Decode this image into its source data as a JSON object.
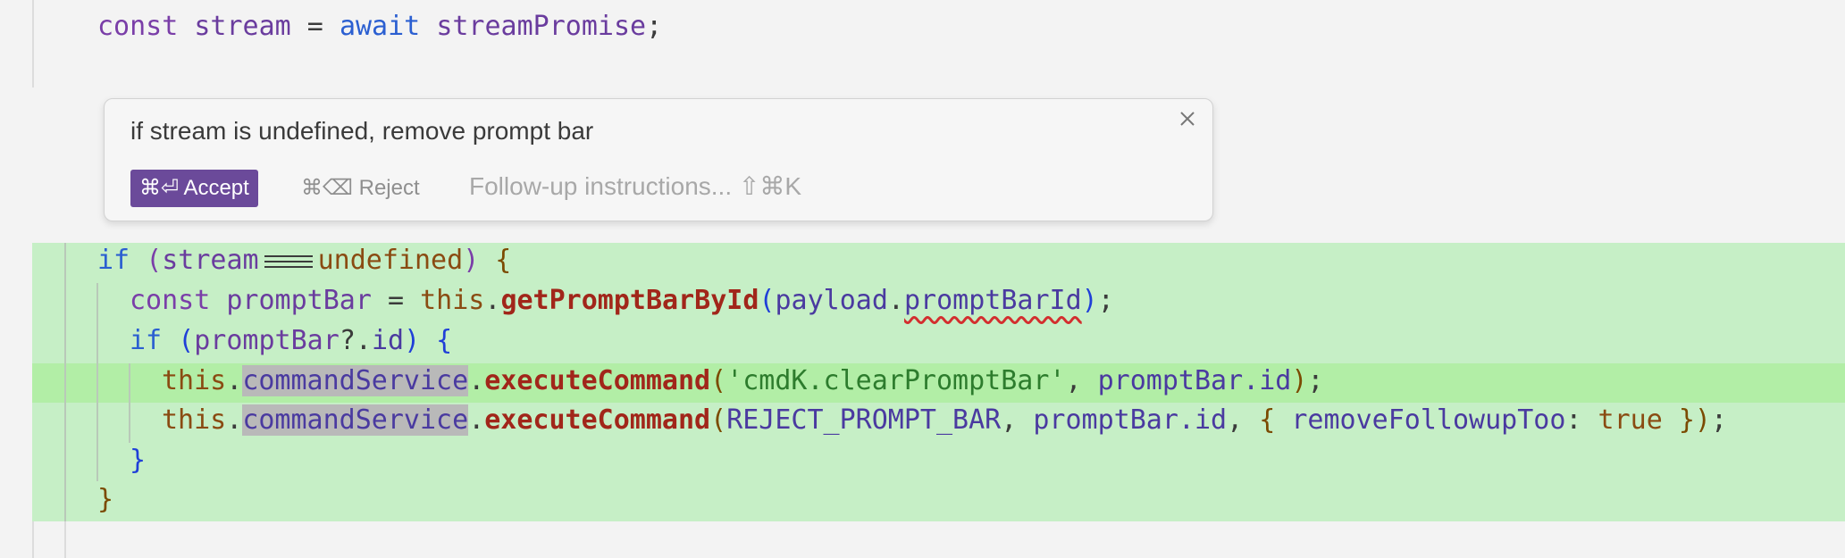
{
  "prompt_bar": {
    "instruction": "if stream is undefined, remove prompt bar",
    "accept_label": "⌘⏎ Accept",
    "reject_label": "⌘⌫ Reject",
    "followup_placeholder": "Follow-up instructions... ⇧⌘K"
  },
  "colors": {
    "added_background": "#c6efc6",
    "added_line_highlight": "#b2eea6",
    "accept_button": "#6b4a9a"
  },
  "code": {
    "line1": {
      "kw_const": "const ",
      "var_stream": "stream",
      "eq": " = ",
      "kw_await": "await ",
      "var_promise": "streamPromise",
      "semi": ";"
    },
    "line2": {
      "kw_if": "if ",
      "lp": "(",
      "var_stream": "stream",
      "var_undefined": "undefined",
      "rp": ")",
      "lb": " {"
    },
    "line3": {
      "kw_const": "const ",
      "var_promptbar": "promptBar",
      "eq": " = ",
      "kw_this": "this",
      "dot": ".",
      "fn_get": "getPromptBarById",
      "lp": "(",
      "var_payload": "payload",
      "dot2": ".",
      "prop_id": "promptBarId",
      "rp": ")",
      "semi": ";"
    },
    "line4": {
      "kw_if": "if ",
      "lp": "(",
      "var_promptbar": "promptBar",
      "optional": "?.",
      "prop": "id",
      "rp": ")",
      "lb": " {"
    },
    "line5": {
      "kw_this": "this",
      "dot": ".",
      "prop_service": "commandService",
      "dot2": ".",
      "fn_exec": "executeCommand",
      "lp": "(",
      "str_cmd": "'cmdK.clearPromptBar'",
      "comma": ", ",
      "var_promptbar_id": "promptBar.id",
      "rp": ")",
      "semi": ";"
    },
    "line6": {
      "kw_this": "this",
      "dot": ".",
      "prop_service": "commandService",
      "dot2": ".",
      "fn_exec": "executeCommand",
      "lp": "(",
      "const_reject": "REJECT_PROMPT_BAR",
      "comma": ", ",
      "var_promptbar_id": "promptBar.id",
      "comma2": ", ",
      "lb": "{ ",
      "prop_remove": "removeFollowupToo",
      "colon": ": ",
      "kw_true": "true",
      "rb": " }",
      "rp": ")",
      "semi": ";"
    },
    "line7": {
      "rb": "}"
    },
    "line8": {
      "rb": "}"
    }
  }
}
